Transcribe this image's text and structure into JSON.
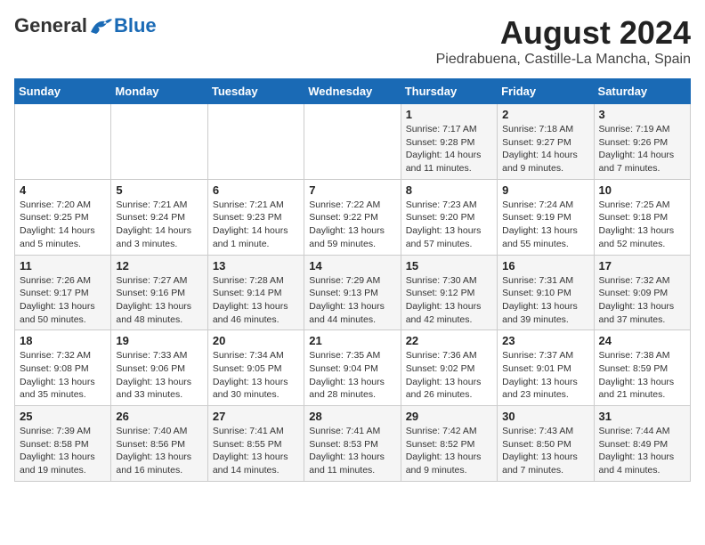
{
  "header": {
    "logo": {
      "general": "General",
      "blue": "Blue"
    },
    "title": "August 2024",
    "subtitle": "Piedrabuena, Castille-La Mancha, Spain"
  },
  "calendar": {
    "days_of_week": [
      "Sunday",
      "Monday",
      "Tuesday",
      "Wednesday",
      "Thursday",
      "Friday",
      "Saturday"
    ],
    "weeks": [
      [
        {
          "day": "",
          "info": ""
        },
        {
          "day": "",
          "info": ""
        },
        {
          "day": "",
          "info": ""
        },
        {
          "day": "",
          "info": ""
        },
        {
          "day": "1",
          "info": "Sunrise: 7:17 AM\nSunset: 9:28 PM\nDaylight: 14 hours and 11 minutes."
        },
        {
          "day": "2",
          "info": "Sunrise: 7:18 AM\nSunset: 9:27 PM\nDaylight: 14 hours and 9 minutes."
        },
        {
          "day": "3",
          "info": "Sunrise: 7:19 AM\nSunset: 9:26 PM\nDaylight: 14 hours and 7 minutes."
        }
      ],
      [
        {
          "day": "4",
          "info": "Sunrise: 7:20 AM\nSunset: 9:25 PM\nDaylight: 14 hours and 5 minutes."
        },
        {
          "day": "5",
          "info": "Sunrise: 7:21 AM\nSunset: 9:24 PM\nDaylight: 14 hours and 3 minutes."
        },
        {
          "day": "6",
          "info": "Sunrise: 7:21 AM\nSunset: 9:23 PM\nDaylight: 14 hours and 1 minute."
        },
        {
          "day": "7",
          "info": "Sunrise: 7:22 AM\nSunset: 9:22 PM\nDaylight: 13 hours and 59 minutes."
        },
        {
          "day": "8",
          "info": "Sunrise: 7:23 AM\nSunset: 9:20 PM\nDaylight: 13 hours and 57 minutes."
        },
        {
          "day": "9",
          "info": "Sunrise: 7:24 AM\nSunset: 9:19 PM\nDaylight: 13 hours and 55 minutes."
        },
        {
          "day": "10",
          "info": "Sunrise: 7:25 AM\nSunset: 9:18 PM\nDaylight: 13 hours and 52 minutes."
        }
      ],
      [
        {
          "day": "11",
          "info": "Sunrise: 7:26 AM\nSunset: 9:17 PM\nDaylight: 13 hours and 50 minutes."
        },
        {
          "day": "12",
          "info": "Sunrise: 7:27 AM\nSunset: 9:16 PM\nDaylight: 13 hours and 48 minutes."
        },
        {
          "day": "13",
          "info": "Sunrise: 7:28 AM\nSunset: 9:14 PM\nDaylight: 13 hours and 46 minutes."
        },
        {
          "day": "14",
          "info": "Sunrise: 7:29 AM\nSunset: 9:13 PM\nDaylight: 13 hours and 44 minutes."
        },
        {
          "day": "15",
          "info": "Sunrise: 7:30 AM\nSunset: 9:12 PM\nDaylight: 13 hours and 42 minutes."
        },
        {
          "day": "16",
          "info": "Sunrise: 7:31 AM\nSunset: 9:10 PM\nDaylight: 13 hours and 39 minutes."
        },
        {
          "day": "17",
          "info": "Sunrise: 7:32 AM\nSunset: 9:09 PM\nDaylight: 13 hours and 37 minutes."
        }
      ],
      [
        {
          "day": "18",
          "info": "Sunrise: 7:32 AM\nSunset: 9:08 PM\nDaylight: 13 hours and 35 minutes."
        },
        {
          "day": "19",
          "info": "Sunrise: 7:33 AM\nSunset: 9:06 PM\nDaylight: 13 hours and 33 minutes."
        },
        {
          "day": "20",
          "info": "Sunrise: 7:34 AM\nSunset: 9:05 PM\nDaylight: 13 hours and 30 minutes."
        },
        {
          "day": "21",
          "info": "Sunrise: 7:35 AM\nSunset: 9:04 PM\nDaylight: 13 hours and 28 minutes."
        },
        {
          "day": "22",
          "info": "Sunrise: 7:36 AM\nSunset: 9:02 PM\nDaylight: 13 hours and 26 minutes."
        },
        {
          "day": "23",
          "info": "Sunrise: 7:37 AM\nSunset: 9:01 PM\nDaylight: 13 hours and 23 minutes."
        },
        {
          "day": "24",
          "info": "Sunrise: 7:38 AM\nSunset: 8:59 PM\nDaylight: 13 hours and 21 minutes."
        }
      ],
      [
        {
          "day": "25",
          "info": "Sunrise: 7:39 AM\nSunset: 8:58 PM\nDaylight: 13 hours and 19 minutes."
        },
        {
          "day": "26",
          "info": "Sunrise: 7:40 AM\nSunset: 8:56 PM\nDaylight: 13 hours and 16 minutes."
        },
        {
          "day": "27",
          "info": "Sunrise: 7:41 AM\nSunset: 8:55 PM\nDaylight: 13 hours and 14 minutes."
        },
        {
          "day": "28",
          "info": "Sunrise: 7:41 AM\nSunset: 8:53 PM\nDaylight: 13 hours and 11 minutes."
        },
        {
          "day": "29",
          "info": "Sunrise: 7:42 AM\nSunset: 8:52 PM\nDaylight: 13 hours and 9 minutes."
        },
        {
          "day": "30",
          "info": "Sunrise: 7:43 AM\nSunset: 8:50 PM\nDaylight: 13 hours and 7 minutes."
        },
        {
          "day": "31",
          "info": "Sunrise: 7:44 AM\nSunset: 8:49 PM\nDaylight: 13 hours and 4 minutes."
        }
      ]
    ]
  }
}
